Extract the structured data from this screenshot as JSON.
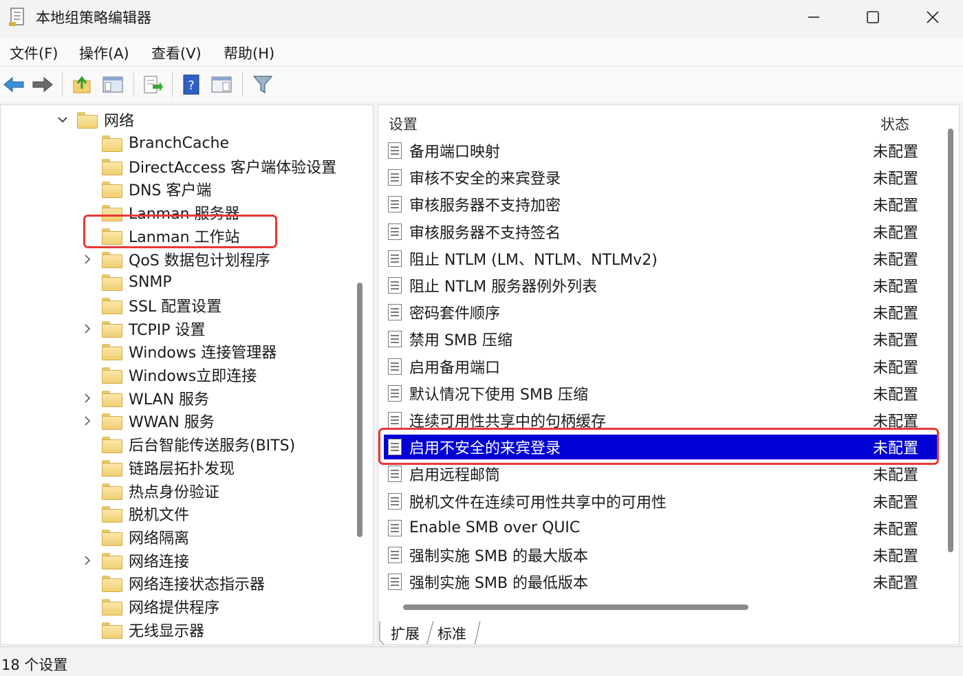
{
  "window": {
    "title": "本地组策略编辑器"
  },
  "menu": [
    {
      "label": "文件(F)"
    },
    {
      "label": "操作(A)"
    },
    {
      "label": "查看(V)"
    },
    {
      "label": "帮助(H)"
    }
  ],
  "toolbar": {
    "icons": [
      "back-arrow-icon",
      "forward-arrow-icon",
      "up-folder-icon",
      "show-hide-tree-icon",
      "export-list-icon",
      "help-icon",
      "properties-view-icon",
      "filter-icon"
    ]
  },
  "tree": {
    "parent": "网络",
    "items": [
      {
        "label": "BranchCache",
        "expandable": false
      },
      {
        "label": "DirectAccess 客户端体验设置",
        "expandable": false
      },
      {
        "label": "DNS 客户端",
        "expandable": false
      },
      {
        "label": "Lanman 服务器",
        "expandable": false
      },
      {
        "label": "Lanman 工作站",
        "expandable": false,
        "selected": true
      },
      {
        "label": "QoS 数据包计划程序",
        "expandable": true
      },
      {
        "label": "SNMP",
        "expandable": false
      },
      {
        "label": "SSL 配置设置",
        "expandable": false
      },
      {
        "label": "TCPIP 设置",
        "expandable": true
      },
      {
        "label": "Windows 连接管理器",
        "expandable": false
      },
      {
        "label": "Windows立即连接",
        "expandable": false
      },
      {
        "label": "WLAN 服务",
        "expandable": true
      },
      {
        "label": "WWAN 服务",
        "expandable": true
      },
      {
        "label": "后台智能传送服务(BITS)",
        "expandable": false
      },
      {
        "label": "链路层拓扑发现",
        "expandable": false
      },
      {
        "label": "热点身份验证",
        "expandable": false
      },
      {
        "label": "脱机文件",
        "expandable": false
      },
      {
        "label": "网络隔离",
        "expandable": false
      },
      {
        "label": "网络连接",
        "expandable": true
      },
      {
        "label": "网络连接状态指示器",
        "expandable": false
      },
      {
        "label": "网络提供程序",
        "expandable": false
      },
      {
        "label": "无线显示器",
        "expandable": false
      }
    ]
  },
  "list": {
    "col_setting": "设置",
    "col_state": "状态",
    "rows": [
      {
        "name": "备用端口映射",
        "state": "未配置"
      },
      {
        "name": "审核不安全的来宾登录",
        "state": "未配置"
      },
      {
        "name": "审核服务器不支持加密",
        "state": "未配置"
      },
      {
        "name": "审核服务器不支持签名",
        "state": "未配置"
      },
      {
        "name": "阻止 NTLM (LM、NTLM、NTLMv2)",
        "state": "未配置"
      },
      {
        "name": "阻止 NTLM 服务器例外列表",
        "state": "未配置"
      },
      {
        "name": "密码套件顺序",
        "state": "未配置"
      },
      {
        "name": "禁用 SMB 压缩",
        "state": "未配置"
      },
      {
        "name": "启用备用端口",
        "state": "未配置"
      },
      {
        "name": "默认情况下使用 SMB 压缩",
        "state": "未配置"
      },
      {
        "name": "连续可用性共享中的句柄缓存",
        "state": "未配置"
      },
      {
        "name": "启用不安全的来宾登录",
        "state": "未配置",
        "selected": true
      },
      {
        "name": "启用远程邮筒",
        "state": "未配置"
      },
      {
        "name": "脱机文件在连续可用性共享中的可用性",
        "state": "未配置"
      },
      {
        "name": "Enable SMB over QUIC",
        "state": "未配置"
      },
      {
        "name": "强制实施 SMB 的最大版本",
        "state": "未配置"
      },
      {
        "name": "强制实施 SMB 的最低版本",
        "state": "未配置"
      }
    ]
  },
  "tabs": [
    {
      "label": "扩展"
    },
    {
      "label": "标准"
    }
  ],
  "status": {
    "text": "18 个设置"
  },
  "colors": {
    "selection": "#0000d4",
    "annotation": "#e53935"
  }
}
